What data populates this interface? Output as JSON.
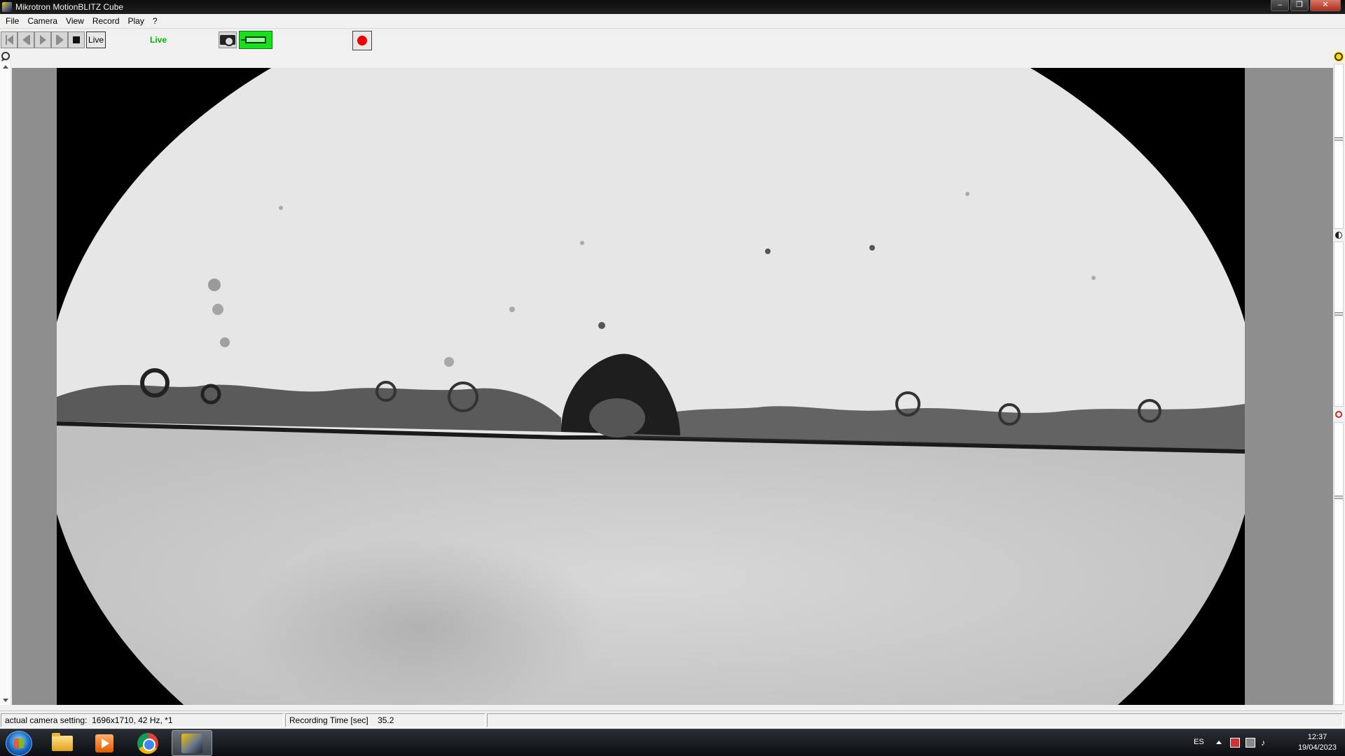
{
  "window": {
    "title": "Mikrotron MotionBLITZ Cube"
  },
  "menu": [
    "File",
    "Camera",
    "View",
    "Record",
    "Play",
    "?"
  ],
  "toolbar": {
    "live_button": "Live",
    "live_status": "Live"
  },
  "statusbar": {
    "camera_setting_label": "actual camera setting:",
    "camera_setting_value": "1696x1710, 42 Hz, *1",
    "recording_time_label": "Recording Time [sec]",
    "recording_time_value": "35.2"
  },
  "taskbar": {
    "language": "ES",
    "time": "12:37",
    "date": "19/04/2023"
  },
  "colors": {
    "live_status": "#00b400",
    "connect_button": "#19e01d",
    "record_dot": "#f00000"
  }
}
